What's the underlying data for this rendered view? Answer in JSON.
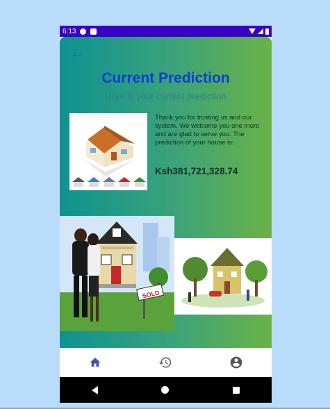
{
  "status_bar": {
    "time": "6:13"
  },
  "header": {
    "back_icon": "arrow-left-icon",
    "title": "Current Prediction",
    "subtitle": "Here is your current prediction"
  },
  "prediction": {
    "message": "Thank you for trusting us and our system. We welcome you one more and are glad to serve you. The prediction of your house is:",
    "price": "Ksh381,721,328.74"
  },
  "images": {
    "sold_sign_text": "SOLD"
  },
  "bottom_nav": {
    "items": [
      {
        "icon": "home-icon",
        "color": "#3f51b5",
        "active": true
      },
      {
        "icon": "history-icon",
        "color": "#666666",
        "active": false
      },
      {
        "icon": "account-icon",
        "color": "#555555",
        "active": false
      }
    ]
  },
  "colors": {
    "gradient_start": "#0e9292",
    "gradient_end": "#6ab245",
    "title": "#0d3fd3",
    "status_bar": "#3a00c4"
  }
}
